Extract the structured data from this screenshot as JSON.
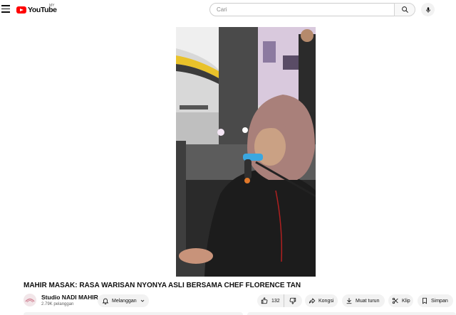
{
  "header": {
    "logo_text": "YouTube",
    "country_code": "MY",
    "search_placeholder": "Cari"
  },
  "video": {
    "title": "MAHIR MASAK: RASA WARISAN NYONYA ASLI BERSAMA CHEF FLORENCE TAN"
  },
  "channel": {
    "name": "Studio NADI MAHIR",
    "subscribers": "2.79K pelanggan"
  },
  "actions": {
    "subscribe_label": "Melanggan",
    "like_count": "132",
    "share_label": "Kongsi",
    "download_label": "Muat turun",
    "clip_label": "Klip",
    "save_label": "Simpan"
  },
  "colors": {
    "brand": "#ff0000",
    "pill_bg": "#f2f2f2",
    "text": "#0f0f0f",
    "secondary_text": "#606060"
  },
  "icons": [
    "menu-icon",
    "youtube-logo-icon",
    "search-icon",
    "mic-icon",
    "bell-icon",
    "chevron-down-icon",
    "thumbs-up-icon",
    "thumbs-down-icon",
    "share-icon",
    "download-icon",
    "scissors-icon",
    "bookmark-icon"
  ]
}
